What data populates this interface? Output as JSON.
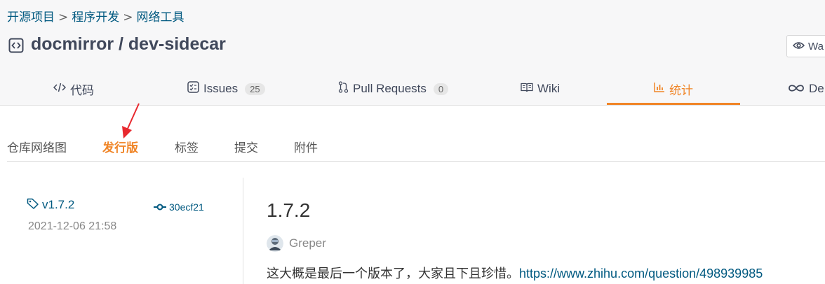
{
  "breadcrumb": {
    "items": [
      "开源项目",
      "程序开发",
      "网络工具"
    ],
    "separator": ">"
  },
  "repo": {
    "title": "docmirror / dev-sidecar"
  },
  "watch_button": {
    "label": "Wa"
  },
  "tabs": [
    {
      "label": "代码",
      "icon": "code-icon"
    },
    {
      "label": "Issues",
      "icon": "issues-icon",
      "count": "25"
    },
    {
      "label": "Pull Requests",
      "icon": "pull-request-icon",
      "count": "0"
    },
    {
      "label": "Wiki",
      "icon": "wiki-icon"
    },
    {
      "label": "统计",
      "icon": "chart-icon",
      "active": true
    },
    {
      "label": "De",
      "icon": "infinity-icon"
    }
  ],
  "subnav": [
    "仓库网络图",
    "发行版",
    "标签",
    "提交",
    "附件"
  ],
  "subnav_active": "发行版",
  "release": {
    "tag": "v1.7.2",
    "commit": "30ecf21",
    "date": "2021-12-06 21:58",
    "title": "1.7.2",
    "author": "Greper",
    "body_text": "这大概是最后一个版本了，大家且下且珍惜。",
    "body_link": "https://www.zhihu.com/question/498939985"
  },
  "colors": {
    "accent": "#f08527",
    "link": "#005980",
    "annotation_arrow": "#e8282e"
  }
}
